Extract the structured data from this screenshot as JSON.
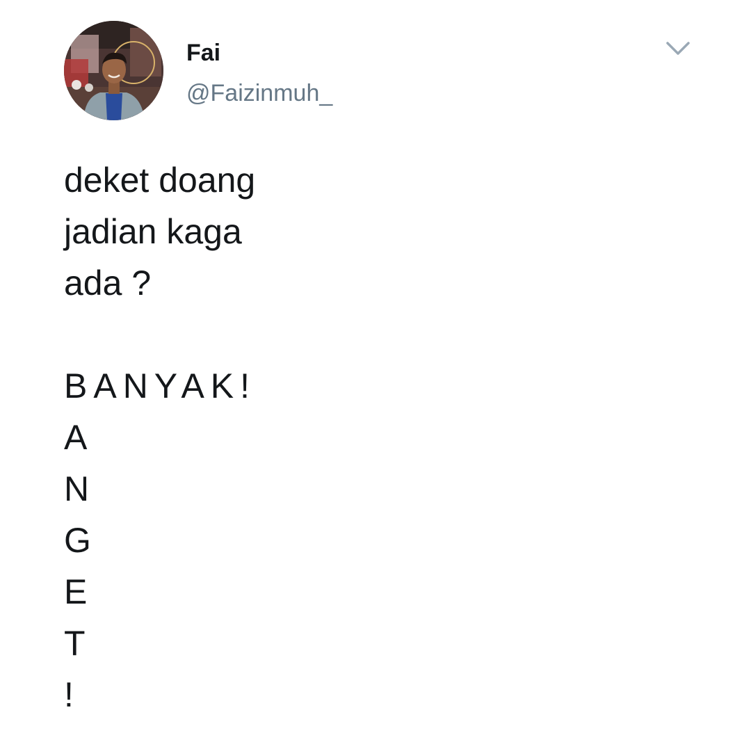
{
  "tweet": {
    "author": {
      "display_name": "Fai",
      "handle": "@Faizinmuh_",
      "avatar_icon": "profile-photo"
    },
    "menu_icon": "chevron-down-icon",
    "text_lines": [
      "deket doang",
      "jadian kaga",
      "ada ?",
      "",
      "BANYAK!",
      "A",
      "N",
      "G",
      "E",
      "T",
      "!"
    ]
  },
  "colors": {
    "text": "#14171a",
    "secondary_text": "#657786",
    "caret": "#9aa8b5",
    "background": "#ffffff"
  }
}
